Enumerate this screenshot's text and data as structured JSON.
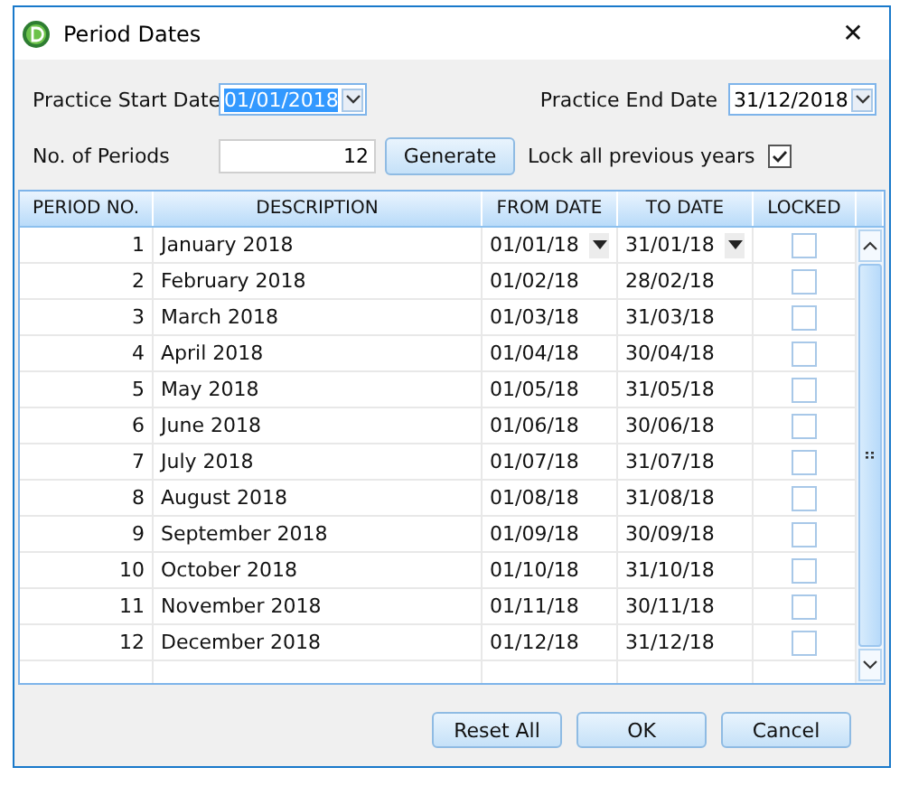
{
  "window": {
    "title": "Period Dates",
    "close": "✕"
  },
  "form": {
    "start_label": "Practice Start Date",
    "start_value": "01/01/2018",
    "start_selected": true,
    "end_label": "Practice End Date",
    "end_value": "31/12/2018",
    "periods_label": "No. of Periods",
    "periods_value": "12",
    "generate": "Generate",
    "lock_label": "Lock all previous years",
    "lock_checked": true
  },
  "table": {
    "columns": [
      "PERIOD NO.",
      "DESCRIPTION",
      "FROM DATE",
      "TO DATE",
      "LOCKED"
    ],
    "rows": [
      {
        "period": "1",
        "description": "January 2018",
        "from": "01/01/18",
        "to": "31/01/18",
        "locked": false,
        "selected": true
      },
      {
        "period": "2",
        "description": "February 2018",
        "from": "01/02/18",
        "to": "28/02/18",
        "locked": false,
        "selected": false
      },
      {
        "period": "3",
        "description": "March 2018",
        "from": "01/03/18",
        "to": "31/03/18",
        "locked": false,
        "selected": false
      },
      {
        "period": "4",
        "description": "April 2018",
        "from": "01/04/18",
        "to": "30/04/18",
        "locked": false,
        "selected": false
      },
      {
        "period": "5",
        "description": "May 2018",
        "from": "01/05/18",
        "to": "31/05/18",
        "locked": false,
        "selected": false
      },
      {
        "period": "6",
        "description": "June 2018",
        "from": "01/06/18",
        "to": "30/06/18",
        "locked": false,
        "selected": false
      },
      {
        "period": "7",
        "description": "July 2018",
        "from": "01/07/18",
        "to": "31/07/18",
        "locked": false,
        "selected": false
      },
      {
        "period": "8",
        "description": "August 2018",
        "from": "01/08/18",
        "to": "31/08/18",
        "locked": false,
        "selected": false
      },
      {
        "period": "9",
        "description": "September 2018",
        "from": "01/09/18",
        "to": "30/09/18",
        "locked": false,
        "selected": false
      },
      {
        "period": "10",
        "description": "October 2018",
        "from": "01/10/18",
        "to": "31/10/18",
        "locked": false,
        "selected": false
      },
      {
        "period": "11",
        "description": "November 2018",
        "from": "01/11/18",
        "to": "30/11/18",
        "locked": false,
        "selected": false
      },
      {
        "period": "12",
        "description": "December 2018",
        "from": "01/12/18",
        "to": "31/12/18",
        "locked": false,
        "selected": false
      }
    ]
  },
  "buttons": [
    "Reset All",
    "OK",
    "Cancel"
  ]
}
